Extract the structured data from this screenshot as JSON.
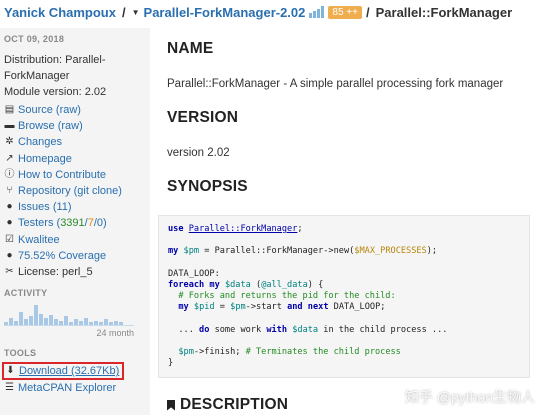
{
  "header": {
    "author": "Yanick Champoux",
    "separator": "/",
    "distribution": "Parallel-ForkManager-2.02",
    "badge": "85 ++",
    "module": "Parallel::ForkManager"
  },
  "sidebar": {
    "date": "OCT 09, 2018",
    "distribution_line1": "Distribution: Parallel-",
    "distribution_line2": "ForkManager",
    "module_version": "Module version: 2.02",
    "links": [
      {
        "icon": "file-code-icon",
        "label": "Source (raw)"
      },
      {
        "icon": "folder-icon",
        "label": "Browse (raw)"
      },
      {
        "icon": "gears-icon",
        "label": "Changes"
      },
      {
        "icon": "external-link-icon",
        "label": "Homepage"
      },
      {
        "icon": "info-icon",
        "label": "How to Contribute"
      },
      {
        "icon": "code-fork-icon",
        "label": "Repository (git clone)"
      },
      {
        "icon": "exclamation-circle-icon",
        "label": "Issues (11)"
      }
    ],
    "testers": {
      "label": "Testers (",
      "pass": "3391",
      "slash1": " / ",
      "fail": "7",
      "slash2": " / ",
      "na": "0",
      "close": ")"
    },
    "kwalitee": "Kwalitee",
    "coverage": "75.52% Coverage",
    "license": "License: perl_5",
    "activity_title": "ACTIVITY",
    "activity_range": "24 month",
    "activity_values": [
      2,
      5,
      3,
      9,
      4,
      6,
      14,
      8,
      5,
      7,
      4,
      3,
      6,
      2,
      4,
      3,
      5,
      2,
      3,
      2,
      4,
      2,
      3,
      2
    ],
    "tools_title": "TOOLS",
    "download": "Download (32.67Kb)",
    "metacpan": "MetaCPAN Explorer"
  },
  "main": {
    "name_heading": "NAME",
    "name_text": "Parallel::ForkManager - A simple parallel processing fork manager",
    "version_heading": "VERSION",
    "version_text": "version 2.02",
    "synopsis_heading": "SYNOPSIS",
    "description_heading": "DESCRIPTION"
  },
  "code": {
    "l1_kw": "use",
    "l1_pkg": "Parallel::ForkManager",
    "l1_end": ";",
    "l2_kw": "my",
    "l2_var": "$pm",
    "l2_mid": " = Parallel::ForkManager->new(",
    "l2_cst": "$MAX_PROCESSES",
    "l2_end": ");",
    "l3": "DATA_LOOP:",
    "l4_kw": "foreach",
    "l4_kw2": "my",
    "l4_var": "$data",
    "l4_mid": " (",
    "l4_arr": "@all_data",
    "l4_end": ") {",
    "l5": "  # Forks and returns the pid for the child:",
    "l6_kw": "my",
    "l6_var": "$pid",
    "l6_mid": " = ",
    "l6_var2": "$pm",
    "l6_mid2": "->start ",
    "l6_kw2": "and",
    "l6_kw3": "next",
    "l6_end": " DATA_LOOP;",
    "l7_a": "  ... ",
    "l7_kw": "do",
    "l7_b": " some work ",
    "l7_kw2": "with",
    "l7_var": "$data",
    "l7_c": " in the child process ...",
    "l8_var": "$pm",
    "l8_mid": "->finish; ",
    "l8_cmt": "# Terminates the child process",
    "l9": "}"
  },
  "watermark": "知乎 @python生物人"
}
